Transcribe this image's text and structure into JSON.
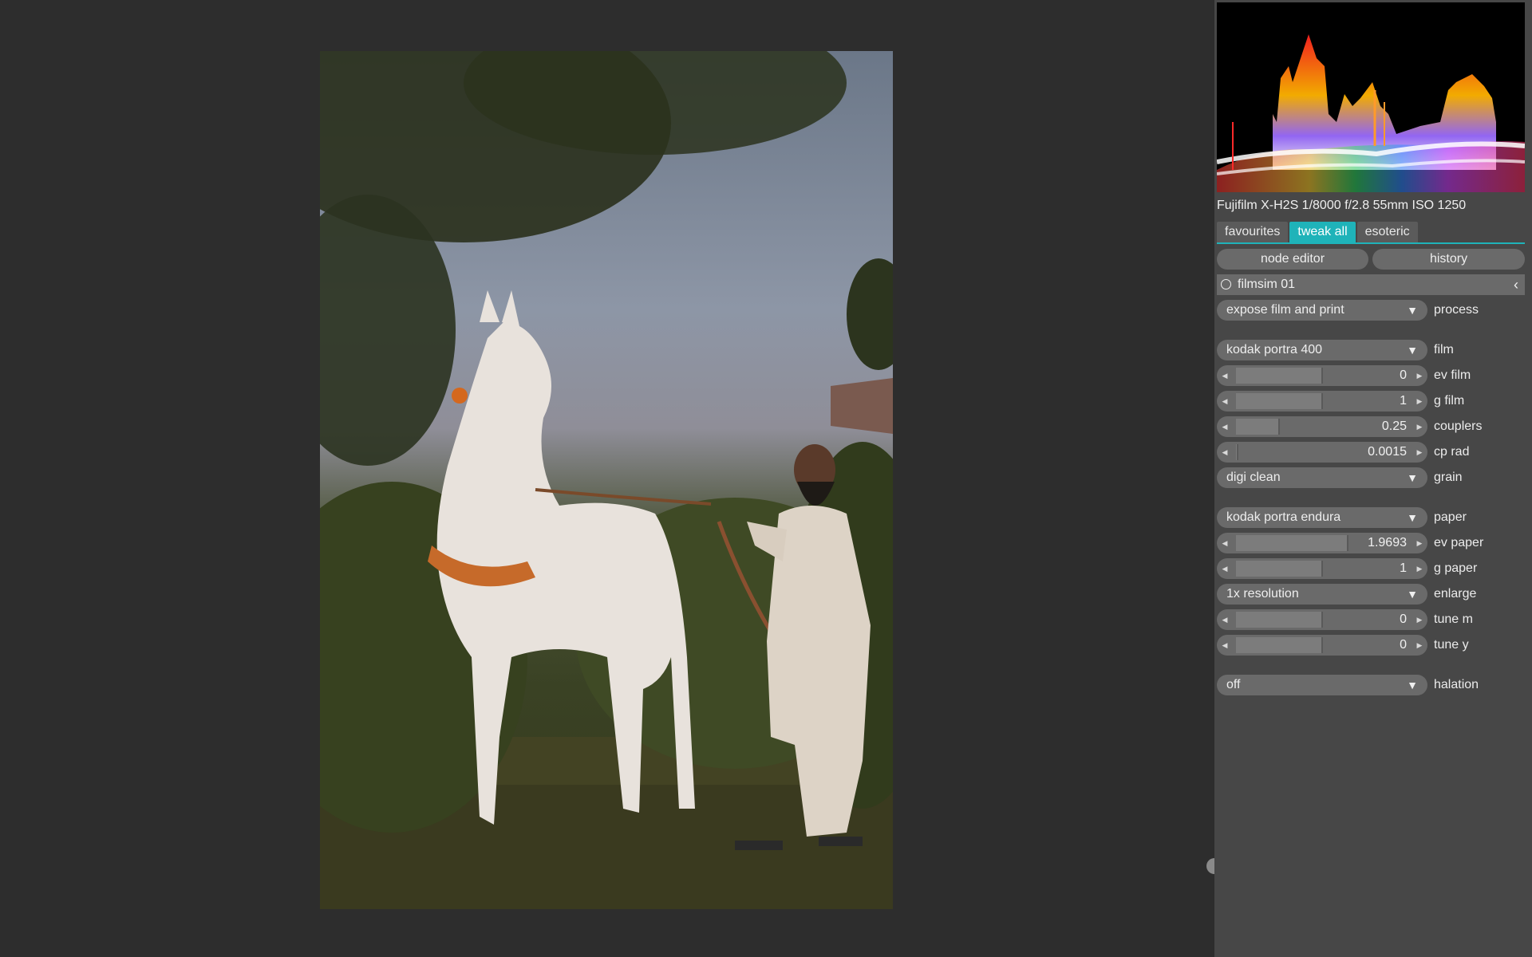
{
  "viewport": {
    "scroll_handle": "scroll-handle"
  },
  "photo": {
    "description_icon": "photo-image"
  },
  "panel": {
    "exif": "Fujifilm X-H2S 1/8000 f/2.8 55mm ISO 1250",
    "tabs": [
      {
        "label": "favourites",
        "active": false
      },
      {
        "label": "tweak all",
        "active": true
      },
      {
        "label": "esoteric",
        "active": false
      }
    ],
    "buttons": {
      "node_editor": "node editor",
      "history": "history"
    },
    "module": {
      "name": "filmsim 01",
      "collapse_icon": "chevron-left-icon"
    },
    "controls": {
      "process": {
        "value": "expose film and print",
        "label": "process"
      },
      "film": {
        "value": "kodak portra 400",
        "label": "film"
      },
      "ev_film": {
        "value": "0",
        "label": "ev film",
        "fraction": 0.5
      },
      "g_film": {
        "value": "1",
        "label": "g film",
        "fraction": 0.5
      },
      "couplers": {
        "value": "0.25",
        "label": "couplers",
        "fraction": 0.25
      },
      "cp_rad": {
        "value": "0.0015",
        "label": "cp rad",
        "fraction": 0.01
      },
      "grain": {
        "value": "digi clean",
        "label": "grain"
      },
      "paper": {
        "value": "kodak portra endura",
        "label": "paper"
      },
      "ev_paper": {
        "value": "1.9693",
        "label": "ev paper",
        "fraction": 0.65
      },
      "g_paper": {
        "value": "1",
        "label": "g paper",
        "fraction": 0.5
      },
      "enlarge": {
        "value": "1x resolution",
        "label": "enlarge"
      },
      "tune_m": {
        "value": "0",
        "label": "tune m",
        "fraction": 0.5
      },
      "tune_y": {
        "value": "0",
        "label": "tune y",
        "fraction": 0.5
      },
      "halation": {
        "value": "off",
        "label": "halation"
      }
    }
  },
  "colors": {
    "accent": "#1fb3b9",
    "panel": "#474747",
    "background": "#2d2d2d"
  }
}
